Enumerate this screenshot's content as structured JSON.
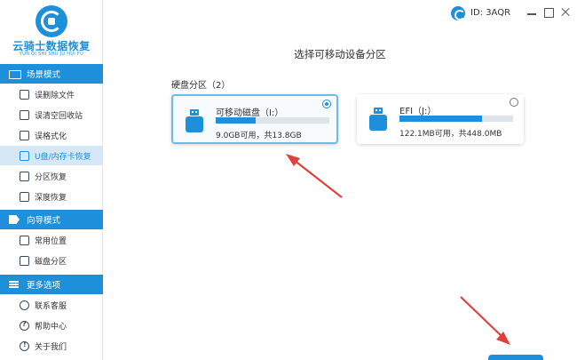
{
  "app": {
    "logo_title": "云骑士数据恢复",
    "logo_subtitle": "YUN QI SHI SHU JU HUI FU"
  },
  "sidebar": {
    "sections": [
      {
        "header": "场景模式",
        "icon": "scene-mode-icon",
        "items": [
          {
            "label": "误删除文件",
            "icon": "deleted-file-icon",
            "active": false
          },
          {
            "label": "误清空回收站",
            "icon": "recycle-bin-icon",
            "active": false
          },
          {
            "label": "误格式化",
            "icon": "format-icon",
            "active": false
          },
          {
            "label": "U盘/内存卡恢复",
            "icon": "usb-card-icon",
            "active": true
          },
          {
            "label": "分区恢复",
            "icon": "partition-icon",
            "active": false
          },
          {
            "label": "深度恢复",
            "icon": "deep-recovery-icon",
            "active": false
          }
        ]
      },
      {
        "header": "向导模式",
        "icon": "guide-mode-icon",
        "items": [
          {
            "label": "常用位置",
            "icon": "common-location-icon",
            "active": false
          },
          {
            "label": "磁盘分区",
            "icon": "disk-partition-icon",
            "active": false
          }
        ]
      },
      {
        "header": "更多选项",
        "icon": "more-options-icon",
        "items": [
          {
            "label": "联系客服",
            "icon": "phone-icon",
            "active": false
          },
          {
            "label": "帮助中心",
            "icon": "help-icon",
            "active": false
          },
          {
            "label": "关于我们",
            "icon": "info-icon",
            "active": false
          }
        ]
      }
    ]
  },
  "topbar": {
    "user_id": "ID: 3AQR"
  },
  "main": {
    "title": "选择可移动设备分区",
    "section_label": "硬盘分区（2）",
    "partitions": [
      {
        "name": "可移动磁盘（I:）",
        "size_text": "9.0GB可用，共13.8GB",
        "used_fraction": 0.35,
        "selected": true
      },
      {
        "name": "EFI（J:）",
        "size_text": "122.1MB可用，共448.0MB",
        "used_fraction": 0.73,
        "selected": false
      }
    ]
  },
  "colors": {
    "accent": "#1e8fdb",
    "active_bg": "#d6e7f5",
    "annotation_arrow": "#e0413c"
  }
}
